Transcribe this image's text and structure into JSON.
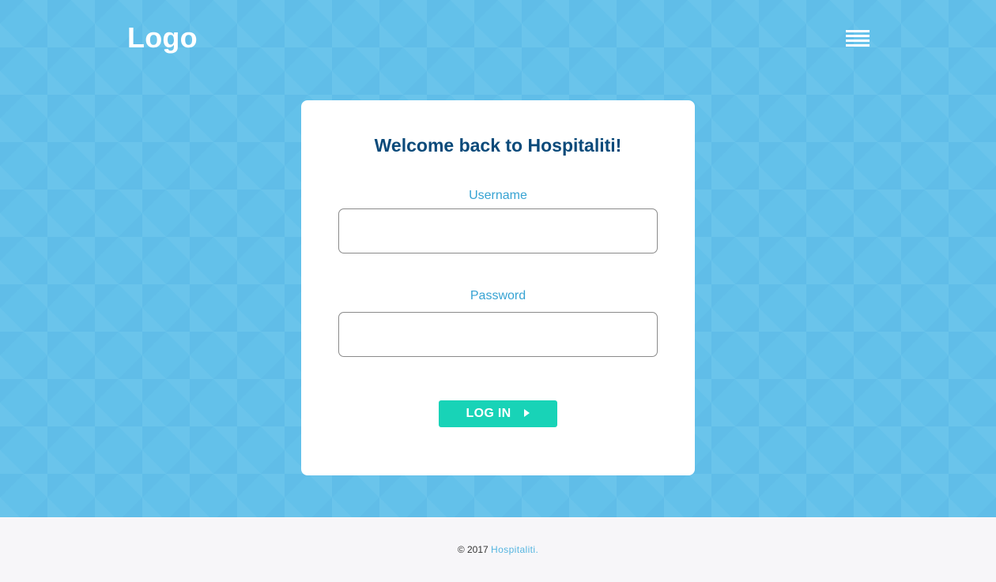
{
  "header": {
    "logo_text": "Logo",
    "menu_icon": "hamburger-menu-icon"
  },
  "login_card": {
    "title": "Welcome back to Hospitaliti!",
    "username": {
      "label": "Username",
      "value": "",
      "placeholder": ""
    },
    "password": {
      "label": "Password",
      "value": "",
      "placeholder": ""
    },
    "submit": {
      "label": "LOG IN",
      "icon": "play-triangle-icon"
    }
  },
  "footer": {
    "copyright": "© 2017",
    "brand_link": "Hospitaliti."
  },
  "colors": {
    "hero_background": "#63c1ea",
    "title": "#0b4a7a",
    "label": "#37a3d3",
    "button": "#18d3b7",
    "footer_background": "#f7f6f9",
    "footer_link": "#55b5e0"
  }
}
